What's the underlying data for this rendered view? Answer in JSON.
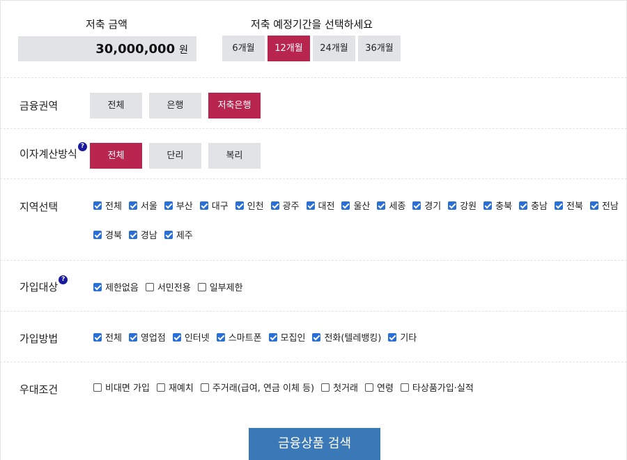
{
  "savings": {
    "amount_label": "저축 금액",
    "amount_value": "30,000,000",
    "amount_unit": "원",
    "period_label": "저축 예정기간을 선택하세요",
    "periods": [
      {
        "label": "6개월",
        "selected": false
      },
      {
        "label": "12개월",
        "selected": true
      },
      {
        "label": "24개월",
        "selected": false
      },
      {
        "label": "36개월",
        "selected": false
      }
    ]
  },
  "sector": {
    "label": "금융권역",
    "options": [
      {
        "label": "전체",
        "selected": false
      },
      {
        "label": "은행",
        "selected": false
      },
      {
        "label": "저축은행",
        "selected": true
      }
    ]
  },
  "interest": {
    "label": "이자계산방식",
    "help": "?",
    "options": [
      {
        "label": "전체",
        "selected": true
      },
      {
        "label": "단리",
        "selected": false
      },
      {
        "label": "복리",
        "selected": false
      }
    ]
  },
  "region": {
    "label": "지역선택",
    "items": [
      {
        "label": "전체",
        "checked": true
      },
      {
        "label": "서울",
        "checked": true
      },
      {
        "label": "부산",
        "checked": true
      },
      {
        "label": "대구",
        "checked": true
      },
      {
        "label": "인천",
        "checked": true
      },
      {
        "label": "광주",
        "checked": true
      },
      {
        "label": "대전",
        "checked": true
      },
      {
        "label": "울산",
        "checked": true
      },
      {
        "label": "세종",
        "checked": true
      },
      {
        "label": "경기",
        "checked": true
      },
      {
        "label": "강원",
        "checked": true
      },
      {
        "label": "충북",
        "checked": true
      },
      {
        "label": "충남",
        "checked": true
      },
      {
        "label": "전북",
        "checked": true
      },
      {
        "label": "전남",
        "checked": true
      },
      {
        "label": "경북",
        "checked": true
      },
      {
        "label": "경남",
        "checked": true
      },
      {
        "label": "제주",
        "checked": true
      }
    ]
  },
  "target": {
    "label": "가입대상",
    "help": "?",
    "items": [
      {
        "label": "제한없음",
        "checked": true
      },
      {
        "label": "서민전용",
        "checked": false
      },
      {
        "label": "일부제한",
        "checked": false
      }
    ]
  },
  "method": {
    "label": "가입방법",
    "items": [
      {
        "label": "전체",
        "checked": true
      },
      {
        "label": "영업점",
        "checked": true
      },
      {
        "label": "인터넷",
        "checked": true
      },
      {
        "label": "스마트폰",
        "checked": true
      },
      {
        "label": "모집인",
        "checked": true
      },
      {
        "label": "전화(텔레뱅킹)",
        "checked": true
      },
      {
        "label": "기타",
        "checked": true
      }
    ]
  },
  "preferential": {
    "label": "우대조건",
    "items": [
      {
        "label": "비대면 가입",
        "checked": false
      },
      {
        "label": "재예치",
        "checked": false
      },
      {
        "label": "주거래(급여, 연금 이체 등)",
        "checked": false
      },
      {
        "label": "첫거래",
        "checked": false
      },
      {
        "label": "연령",
        "checked": false
      },
      {
        "label": "타상품가입·실적",
        "checked": false
      }
    ]
  },
  "search_button": "금융상품 검색",
  "colors": {
    "accent": "#b8264f",
    "button_gray": "#e2e3e7",
    "checkbox": "#2a6fd6",
    "search": "#3a78b8",
    "help_badge": "#1a1aa0"
  }
}
